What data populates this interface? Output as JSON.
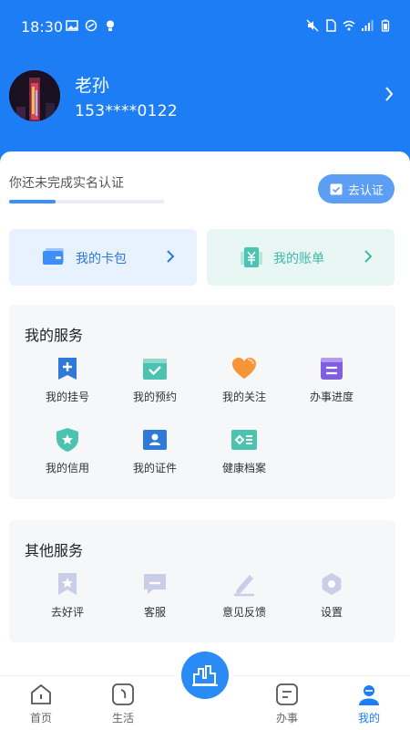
{
  "status_bar": {
    "time": "18:30"
  },
  "profile": {
    "name": "老孙",
    "phone": "153****0122"
  },
  "verification": {
    "text": "你还未完成实名认证",
    "button_label": "去认证",
    "progress": 0.3
  },
  "quick_cards": {
    "wallet_label": "我的卡包",
    "bill_label": "我的账单"
  },
  "my_services": {
    "title": "我的服务",
    "items": [
      {
        "label": "我的挂号",
        "icon": "register-icon"
      },
      {
        "label": "我的预约",
        "icon": "appointment-icon"
      },
      {
        "label": "我的关注",
        "icon": "heart-icon"
      },
      {
        "label": "办事进度",
        "icon": "progress-icon"
      },
      {
        "label": "我的信用",
        "icon": "credit-shield-icon"
      },
      {
        "label": "我的证件",
        "icon": "id-card-icon"
      },
      {
        "label": "健康档案",
        "icon": "health-record-icon"
      }
    ]
  },
  "other_services": {
    "title": "其他服务",
    "items": [
      {
        "label": "去好评",
        "icon": "rating-ribbon-icon"
      },
      {
        "label": "客服",
        "icon": "customer-service-icon"
      },
      {
        "label": "意见反馈",
        "icon": "feedback-pen-icon"
      },
      {
        "label": "设置",
        "icon": "settings-icon"
      }
    ]
  },
  "tab_bar": {
    "tabs": [
      {
        "label": "首页",
        "icon": "home-icon"
      },
      {
        "label": "生活",
        "icon": "life-icon"
      },
      {
        "label": "办事",
        "icon": "tasks-icon"
      },
      {
        "label": "我的",
        "icon": "profile-icon"
      }
    ],
    "active_tab": "我的",
    "center_icon": "city-skyline-icon"
  },
  "colors": {
    "brand_blue": "#1d7df5",
    "verify_button": "#5b9ef3",
    "wallet_text": "#2f7ad8",
    "bill_text": "#3fb8a6",
    "section_bg": "#f6f7f9"
  }
}
